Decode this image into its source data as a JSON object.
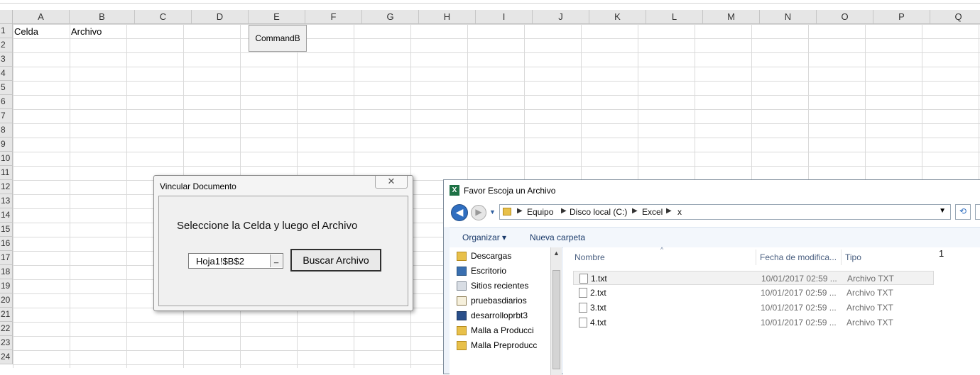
{
  "sheet": {
    "columns": [
      "A",
      "B",
      "C",
      "D",
      "E",
      "F",
      "G",
      "H",
      "I",
      "J",
      "K",
      "L",
      "M",
      "N",
      "O",
      "P",
      "Q"
    ],
    "rows": [
      "1",
      "2",
      "3",
      "4",
      "5",
      "6",
      "7",
      "8",
      "9",
      "10",
      "11",
      "12",
      "13",
      "14",
      "15",
      "16",
      "17",
      "18",
      "19",
      "20",
      "21",
      "22",
      "23",
      "24"
    ],
    "cells": {
      "A1": "Celda",
      "B1": "Archivo"
    },
    "command_button": "CommandB"
  },
  "form": {
    "title": "Vincular Documento",
    "close_glyph": "✕",
    "label": "Seleccione la Celda y luego el Archivo",
    "refedit_value": "Hoja1!$B$2",
    "refedit_button": "_",
    "browse_button": "Buscar Archivo"
  },
  "dialog": {
    "title": "Favor Escoja un Archivo",
    "app_icon": "excel-icon",
    "breadcrumb": [
      "Equipo",
      "Disco local (C:)",
      "Excel",
      "x"
    ],
    "organize_label": "Organizar ▾",
    "new_folder_label": "Nueva carpeta",
    "nav_items": [
      {
        "label": "Descargas",
        "icon": "downloads-folder-icon"
      },
      {
        "label": "Escritorio",
        "icon": "desktop-icon"
      },
      {
        "label": "Sitios recientes",
        "icon": "recent-places-icon"
      },
      {
        "label": "pruebasdiarios",
        "icon": "document-icon"
      },
      {
        "label": "desarrolloprbt3",
        "icon": "computer-icon"
      },
      {
        "label": "Malla a Producci",
        "icon": "folder-icon"
      },
      {
        "label": "Malla Preproducc",
        "icon": "folder-icon"
      }
    ],
    "columns": {
      "name": "Nombre",
      "date": "Fecha de modifica...",
      "type": "Tipo"
    },
    "files": [
      {
        "name": "1.txt",
        "date": "10/01/2017 02:59 ...",
        "type": "Archivo TXT"
      },
      {
        "name": "2.txt",
        "date": "10/01/2017 02:59 ...",
        "type": "Archivo TXT"
      },
      {
        "name": "3.txt",
        "date": "10/01/2017 02:59 ...",
        "type": "Archivo TXT"
      },
      {
        "name": "4.txt",
        "date": "10/01/2017 02:59 ...",
        "type": "Archivo TXT"
      }
    ],
    "preview_text": "1"
  }
}
